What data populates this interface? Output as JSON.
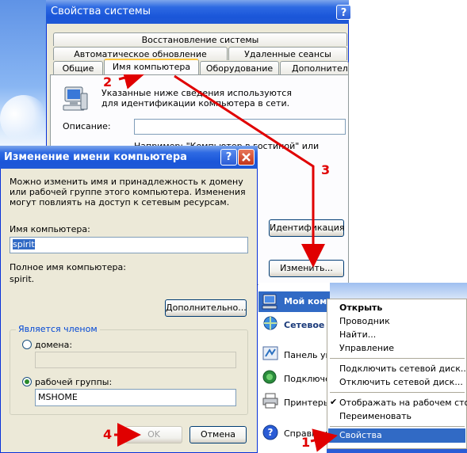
{
  "system_properties": {
    "title": "Свойства системы",
    "help": "?",
    "tabs_row1": [
      "Восстановление системы"
    ],
    "tabs_row2": [
      "Автоматическое обновление",
      "Удаленные сеансы"
    ],
    "tabs_row3": [
      "Общие",
      "Имя компьютера",
      "Оборудование",
      "Дополнительно"
    ],
    "info_text": "Указанные ниже сведения используются для идентификации компьютера в сети.",
    "description_label": "Описание:",
    "description_value": "",
    "example_text": "Например: \"Компьютер в гостиной\" или",
    "identification_button": "Идентификация",
    "change_button": "Изменить..."
  },
  "rename_dialog": {
    "title": "Изменение имени компьютера",
    "help": "?",
    "intro_text": "Можно изменить имя и принадлежность к домену или рабочей группе этого компьютера. Изменения могут повлиять на доступ к сетевым ресурсам.",
    "computer_name_label": "Имя компьютера:",
    "computer_name_value": "spirit",
    "full_name_label": "Полное имя компьютера:",
    "full_name_value": "spirit.",
    "more_button": "Дополнительно...",
    "member_of_label": "Является членом",
    "domain_label": "домена:",
    "domain_value": "",
    "workgroup_label": "рабочей группы:",
    "workgroup_value": "MSHOME",
    "workgroup_selected": true,
    "ok_button": "OK",
    "cancel_button": "Отмена"
  },
  "start_menu": {
    "items": [
      "Мой компь",
      "Сетевое",
      "Панель уп",
      "Подключе",
      "Принтеры",
      "Справка и"
    ]
  },
  "context_menu": {
    "items": [
      {
        "label": "Открыть",
        "bold": true
      },
      {
        "label": "Проводник"
      },
      {
        "label": "Найти..."
      },
      {
        "label": "Управление"
      },
      {
        "label": "Подключить сетевой диск..."
      },
      {
        "label": "Отключить сетевой диск..."
      },
      {
        "label": "Отображать на рабочем столе",
        "checked": true
      },
      {
        "label": "Переименовать"
      },
      {
        "label": "Свойства",
        "highlighted": true
      }
    ]
  },
  "step_labels": [
    "1",
    "2",
    "3",
    "4"
  ],
  "colors": {
    "titlebar": "#1f58d6",
    "highlight": "#316ac5",
    "annotation": "#e00000",
    "dialog_bg": "#ece9d8"
  }
}
